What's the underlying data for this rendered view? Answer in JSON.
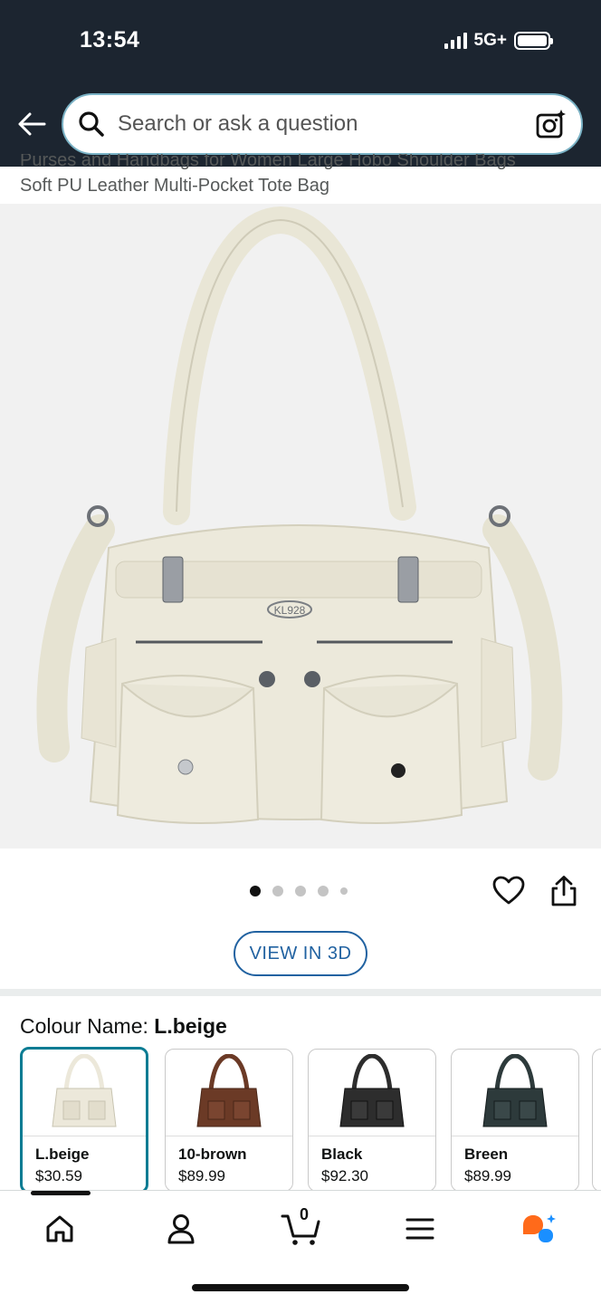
{
  "status": {
    "time": "13:54",
    "network": "5G+"
  },
  "search": {
    "placeholder": "Search or ask a question"
  },
  "product": {
    "title_line1": "Purses and Handbags for Women Large Hobo Shoulder Bags",
    "title_line2": "Soft PU Leather Multi-Pocket Tote Bag",
    "image_alt": "white handbag",
    "brand_mark": "KL928",
    "view3d_label": "VIEW IN 3D",
    "image_count": 5,
    "active_image_index": 0
  },
  "colour": {
    "label": "Colour Name: ",
    "selected": "L.beige",
    "options": [
      {
        "name": "L.beige",
        "price": "$30.59",
        "color": "#ece8da"
      },
      {
        "name": "10-brown",
        "price": "$89.99",
        "color": "#6b3a26"
      },
      {
        "name": "Black",
        "price": "$92.30",
        "color": "#2d2d2d"
      },
      {
        "name": "Breen",
        "price": "$89.99",
        "color": "#2d3a3b"
      }
    ]
  },
  "nav": {
    "cart_count": "0",
    "items": [
      "home-icon",
      "account-icon",
      "cart-icon",
      "menu-icon",
      "rufus-icon"
    ]
  },
  "colors": {
    "header_bg": "#1c2530",
    "accent_blue": "#2162a1",
    "selected_border": "#0b7c93",
    "rufus_orange": "#ff6a1a",
    "rufus_blue": "#1a8fff"
  }
}
